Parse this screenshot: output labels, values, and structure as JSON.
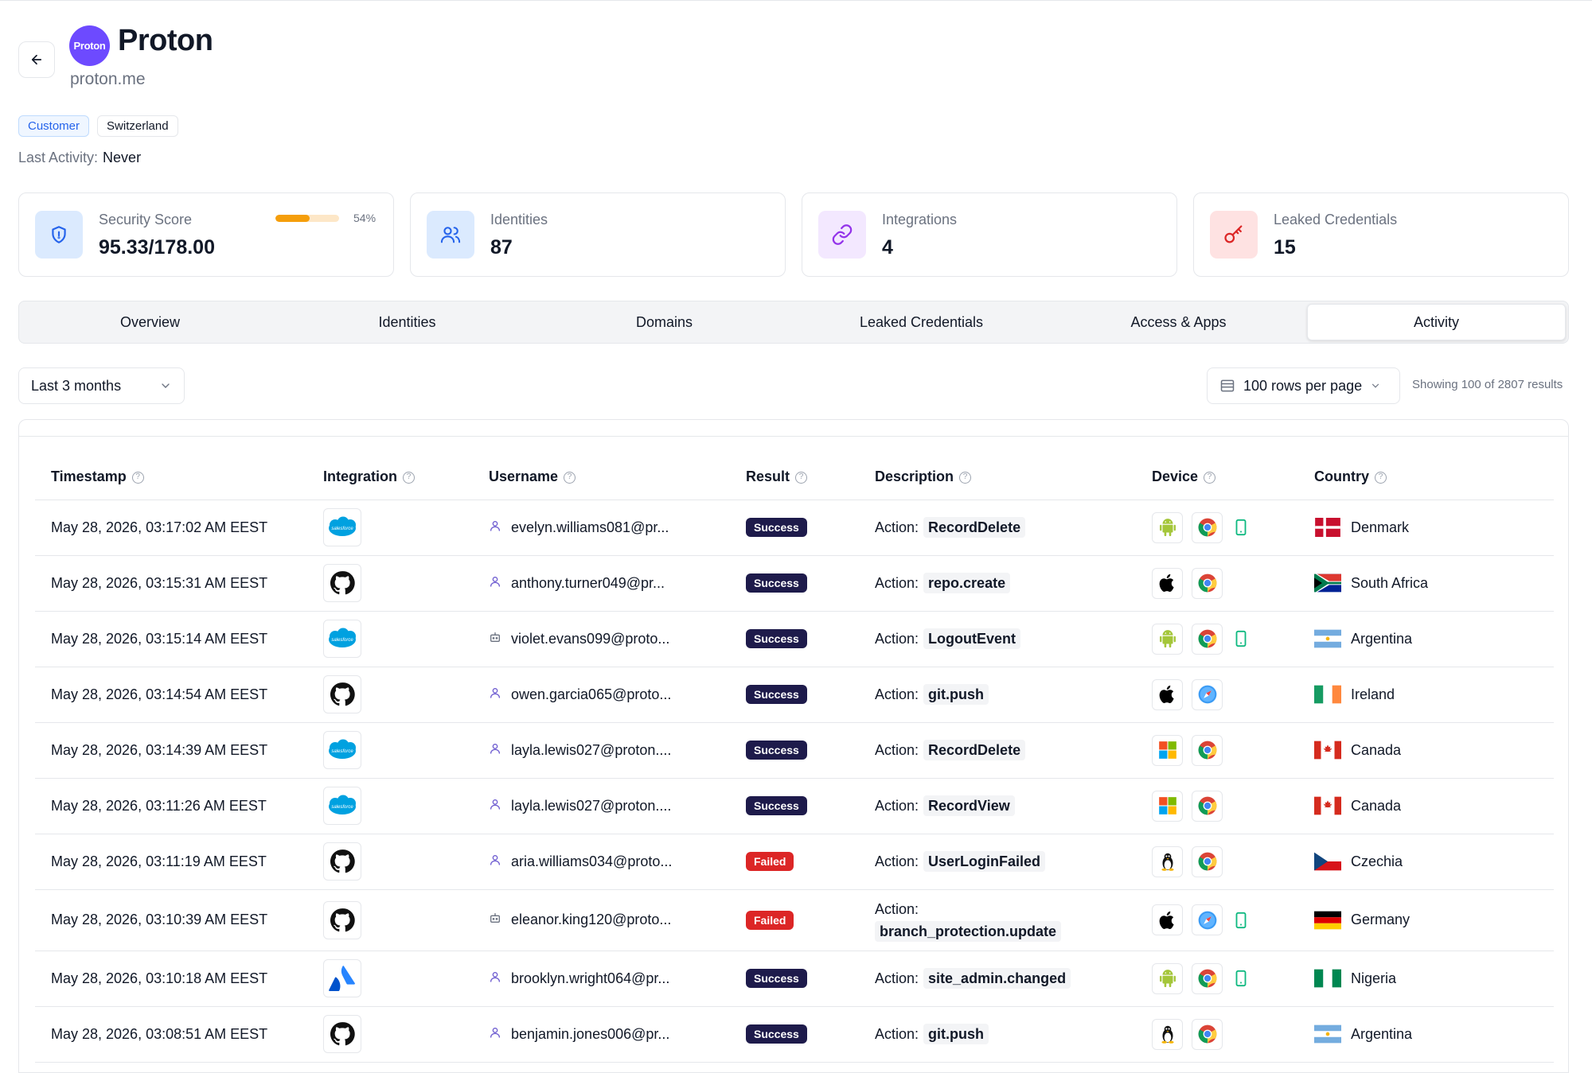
{
  "org": {
    "logo_text": "Proton",
    "name": "Proton",
    "domain": "proton.me",
    "tags": [
      "Customer",
      "Switzerland"
    ],
    "last_activity_label": "Last Activity:",
    "last_activity_value": "Never"
  },
  "cards": {
    "security": {
      "label": "Security Score",
      "value": "95.33/178.00",
      "percent_label": "54%",
      "percent": 0.54
    },
    "identities": {
      "label": "Identities",
      "value": "87"
    },
    "integrations": {
      "label": "Integrations",
      "value": "4"
    },
    "leaked": {
      "label": "Leaked Credentials",
      "value": "15"
    }
  },
  "tabs": [
    "Overview",
    "Identities",
    "Domains",
    "Leaked Credentials",
    "Access & Apps",
    "Activity"
  ],
  "active_tab": "Activity",
  "filters": {
    "range": "Last 3 months",
    "rows_per_page": "100 rows per page",
    "showing": "Showing 100 of 2807 results"
  },
  "table": {
    "headers": [
      "Timestamp",
      "Integration",
      "Username",
      "Result",
      "Description",
      "Device",
      "Country"
    ],
    "rows": [
      {
        "timestamp": "May 28, 2026, 03:17:02 AM EEST",
        "integration": "salesforce",
        "user_type": "person",
        "username": "evelyn.williams081@pr...",
        "result": "Success",
        "action_label": "Action:",
        "action": "RecordDelete",
        "devices": [
          "android",
          "chrome",
          "mobile"
        ],
        "country": "Denmark",
        "flag": "dk"
      },
      {
        "timestamp": "May 28, 2026, 03:15:31 AM EEST",
        "integration": "github",
        "user_type": "person",
        "username": "anthony.turner049@pr...",
        "result": "Success",
        "action_label": "Action:",
        "action": "repo.create",
        "devices": [
          "apple",
          "chrome"
        ],
        "country": "South Africa",
        "flag": "za"
      },
      {
        "timestamp": "May 28, 2026, 03:15:14 AM EEST",
        "integration": "salesforce",
        "user_type": "bot",
        "username": "violet.evans099@proto...",
        "result": "Success",
        "action_label": "Action:",
        "action": "LogoutEvent",
        "devices": [
          "android",
          "chrome",
          "mobile"
        ],
        "country": "Argentina",
        "flag": "ar"
      },
      {
        "timestamp": "May 28, 2026, 03:14:54 AM EEST",
        "integration": "github",
        "user_type": "person",
        "username": "owen.garcia065@proto...",
        "result": "Success",
        "action_label": "Action:",
        "action": "git.push",
        "devices": [
          "apple",
          "safari"
        ],
        "country": "Ireland",
        "flag": "ie"
      },
      {
        "timestamp": "May 28, 2026, 03:14:39 AM EEST",
        "integration": "salesforce",
        "user_type": "person",
        "username": "layla.lewis027@proton....",
        "result": "Success",
        "action_label": "Action:",
        "action": "RecordDelete",
        "devices": [
          "windows",
          "chrome"
        ],
        "country": "Canada",
        "flag": "ca"
      },
      {
        "timestamp": "May 28, 2026, 03:11:26 AM EEST",
        "integration": "salesforce",
        "user_type": "person",
        "username": "layla.lewis027@proton....",
        "result": "Success",
        "action_label": "Action:",
        "action": "RecordView",
        "devices": [
          "windows",
          "chrome"
        ],
        "country": "Canada",
        "flag": "ca"
      },
      {
        "timestamp": "May 28, 2026, 03:11:19 AM EEST",
        "integration": "github",
        "user_type": "person",
        "username": "aria.williams034@proto...",
        "result": "Failed",
        "action_label": "Action:",
        "action": "UserLoginFailed",
        "devices": [
          "linux",
          "chrome"
        ],
        "country": "Czechia",
        "flag": "cz"
      },
      {
        "timestamp": "May 28, 2026, 03:10:39 AM EEST",
        "integration": "github",
        "user_type": "bot",
        "username": "eleanor.king120@proto...",
        "result": "Failed",
        "action_label": "Action:",
        "action": "branch_protection.update",
        "devices": [
          "apple",
          "safari",
          "mobile"
        ],
        "country": "Germany",
        "flag": "de"
      },
      {
        "timestamp": "May 28, 2026, 03:10:18 AM EEST",
        "integration": "atlassian",
        "user_type": "person",
        "username": "brooklyn.wright064@pr...",
        "result": "Success",
        "action_label": "Action:",
        "action": "site_admin.changed",
        "devices": [
          "android",
          "chrome",
          "mobile"
        ],
        "country": "Nigeria",
        "flag": "ng"
      },
      {
        "timestamp": "May 28, 2026, 03:08:51 AM EEST",
        "integration": "github",
        "user_type": "person",
        "username": "benjamin.jones006@pr...",
        "result": "Success",
        "action_label": "Action:",
        "action": "git.push",
        "devices": [
          "linux",
          "chrome"
        ],
        "country": "Argentina",
        "flag": "ar"
      }
    ]
  },
  "colors": {
    "brand": "#6d4aff",
    "success_badge": "#1e1b4b",
    "failed_badge": "#dc2626",
    "progress": "#f59e0b"
  }
}
